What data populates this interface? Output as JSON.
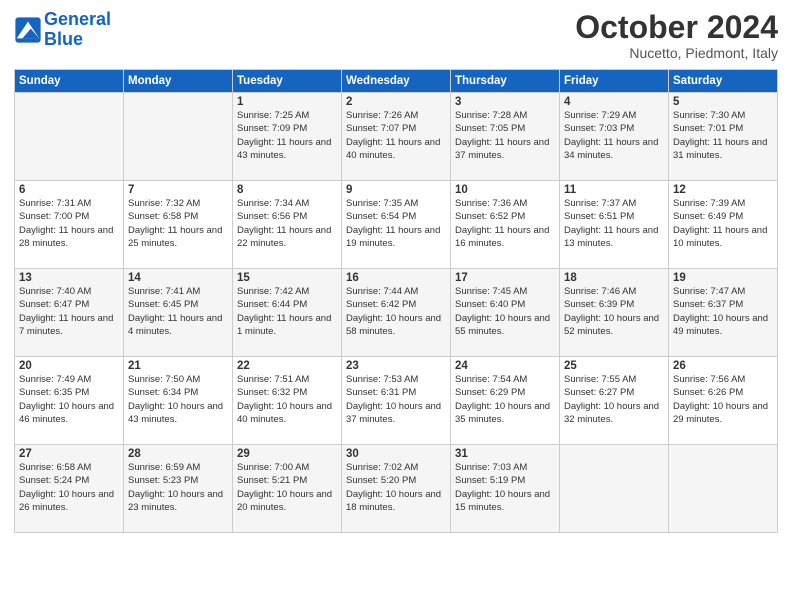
{
  "logo": {
    "line1": "General",
    "line2": "Blue"
  },
  "title": "October 2024",
  "location": "Nucetto, Piedmont, Italy",
  "days_of_week": [
    "Sunday",
    "Monday",
    "Tuesday",
    "Wednesday",
    "Thursday",
    "Friday",
    "Saturday"
  ],
  "weeks": [
    [
      {
        "day": "",
        "sunrise": "",
        "sunset": "",
        "daylight": ""
      },
      {
        "day": "",
        "sunrise": "",
        "sunset": "",
        "daylight": ""
      },
      {
        "day": "1",
        "sunrise": "Sunrise: 7:25 AM",
        "sunset": "Sunset: 7:09 PM",
        "daylight": "Daylight: 11 hours and 43 minutes."
      },
      {
        "day": "2",
        "sunrise": "Sunrise: 7:26 AM",
        "sunset": "Sunset: 7:07 PM",
        "daylight": "Daylight: 11 hours and 40 minutes."
      },
      {
        "day": "3",
        "sunrise": "Sunrise: 7:28 AM",
        "sunset": "Sunset: 7:05 PM",
        "daylight": "Daylight: 11 hours and 37 minutes."
      },
      {
        "day": "4",
        "sunrise": "Sunrise: 7:29 AM",
        "sunset": "Sunset: 7:03 PM",
        "daylight": "Daylight: 11 hours and 34 minutes."
      },
      {
        "day": "5",
        "sunrise": "Sunrise: 7:30 AM",
        "sunset": "Sunset: 7:01 PM",
        "daylight": "Daylight: 11 hours and 31 minutes."
      }
    ],
    [
      {
        "day": "6",
        "sunrise": "Sunrise: 7:31 AM",
        "sunset": "Sunset: 7:00 PM",
        "daylight": "Daylight: 11 hours and 28 minutes."
      },
      {
        "day": "7",
        "sunrise": "Sunrise: 7:32 AM",
        "sunset": "Sunset: 6:58 PM",
        "daylight": "Daylight: 11 hours and 25 minutes."
      },
      {
        "day": "8",
        "sunrise": "Sunrise: 7:34 AM",
        "sunset": "Sunset: 6:56 PM",
        "daylight": "Daylight: 11 hours and 22 minutes."
      },
      {
        "day": "9",
        "sunrise": "Sunrise: 7:35 AM",
        "sunset": "Sunset: 6:54 PM",
        "daylight": "Daylight: 11 hours and 19 minutes."
      },
      {
        "day": "10",
        "sunrise": "Sunrise: 7:36 AM",
        "sunset": "Sunset: 6:52 PM",
        "daylight": "Daylight: 11 hours and 16 minutes."
      },
      {
        "day": "11",
        "sunrise": "Sunrise: 7:37 AM",
        "sunset": "Sunset: 6:51 PM",
        "daylight": "Daylight: 11 hours and 13 minutes."
      },
      {
        "day": "12",
        "sunrise": "Sunrise: 7:39 AM",
        "sunset": "Sunset: 6:49 PM",
        "daylight": "Daylight: 11 hours and 10 minutes."
      }
    ],
    [
      {
        "day": "13",
        "sunrise": "Sunrise: 7:40 AM",
        "sunset": "Sunset: 6:47 PM",
        "daylight": "Daylight: 11 hours and 7 minutes."
      },
      {
        "day": "14",
        "sunrise": "Sunrise: 7:41 AM",
        "sunset": "Sunset: 6:45 PM",
        "daylight": "Daylight: 11 hours and 4 minutes."
      },
      {
        "day": "15",
        "sunrise": "Sunrise: 7:42 AM",
        "sunset": "Sunset: 6:44 PM",
        "daylight": "Daylight: 11 hours and 1 minute."
      },
      {
        "day": "16",
        "sunrise": "Sunrise: 7:44 AM",
        "sunset": "Sunset: 6:42 PM",
        "daylight": "Daylight: 10 hours and 58 minutes."
      },
      {
        "day": "17",
        "sunrise": "Sunrise: 7:45 AM",
        "sunset": "Sunset: 6:40 PM",
        "daylight": "Daylight: 10 hours and 55 minutes."
      },
      {
        "day": "18",
        "sunrise": "Sunrise: 7:46 AM",
        "sunset": "Sunset: 6:39 PM",
        "daylight": "Daylight: 10 hours and 52 minutes."
      },
      {
        "day": "19",
        "sunrise": "Sunrise: 7:47 AM",
        "sunset": "Sunset: 6:37 PM",
        "daylight": "Daylight: 10 hours and 49 minutes."
      }
    ],
    [
      {
        "day": "20",
        "sunrise": "Sunrise: 7:49 AM",
        "sunset": "Sunset: 6:35 PM",
        "daylight": "Daylight: 10 hours and 46 minutes."
      },
      {
        "day": "21",
        "sunrise": "Sunrise: 7:50 AM",
        "sunset": "Sunset: 6:34 PM",
        "daylight": "Daylight: 10 hours and 43 minutes."
      },
      {
        "day": "22",
        "sunrise": "Sunrise: 7:51 AM",
        "sunset": "Sunset: 6:32 PM",
        "daylight": "Daylight: 10 hours and 40 minutes."
      },
      {
        "day": "23",
        "sunrise": "Sunrise: 7:53 AM",
        "sunset": "Sunset: 6:31 PM",
        "daylight": "Daylight: 10 hours and 37 minutes."
      },
      {
        "day": "24",
        "sunrise": "Sunrise: 7:54 AM",
        "sunset": "Sunset: 6:29 PM",
        "daylight": "Daylight: 10 hours and 35 minutes."
      },
      {
        "day": "25",
        "sunrise": "Sunrise: 7:55 AM",
        "sunset": "Sunset: 6:27 PM",
        "daylight": "Daylight: 10 hours and 32 minutes."
      },
      {
        "day": "26",
        "sunrise": "Sunrise: 7:56 AM",
        "sunset": "Sunset: 6:26 PM",
        "daylight": "Daylight: 10 hours and 29 minutes."
      }
    ],
    [
      {
        "day": "27",
        "sunrise": "Sunrise: 6:58 AM",
        "sunset": "Sunset: 5:24 PM",
        "daylight": "Daylight: 10 hours and 26 minutes."
      },
      {
        "day": "28",
        "sunrise": "Sunrise: 6:59 AM",
        "sunset": "Sunset: 5:23 PM",
        "daylight": "Daylight: 10 hours and 23 minutes."
      },
      {
        "day": "29",
        "sunrise": "Sunrise: 7:00 AM",
        "sunset": "Sunset: 5:21 PM",
        "daylight": "Daylight: 10 hours and 20 minutes."
      },
      {
        "day": "30",
        "sunrise": "Sunrise: 7:02 AM",
        "sunset": "Sunset: 5:20 PM",
        "daylight": "Daylight: 10 hours and 18 minutes."
      },
      {
        "day": "31",
        "sunrise": "Sunrise: 7:03 AM",
        "sunset": "Sunset: 5:19 PM",
        "daylight": "Daylight: 10 hours and 15 minutes."
      },
      {
        "day": "",
        "sunrise": "",
        "sunset": "",
        "daylight": ""
      },
      {
        "day": "",
        "sunrise": "",
        "sunset": "",
        "daylight": ""
      }
    ]
  ]
}
